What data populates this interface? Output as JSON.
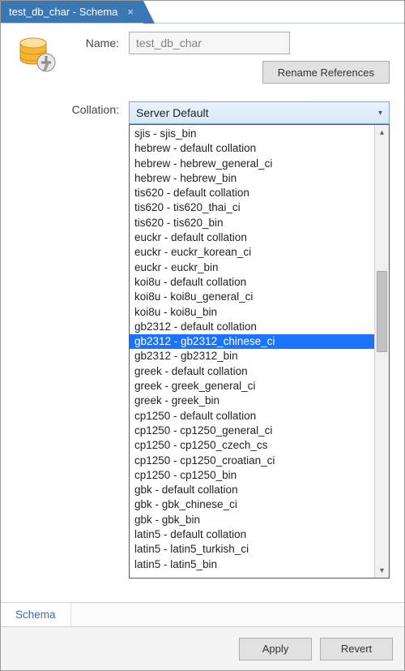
{
  "tab": {
    "title": "test_db_char - Schema",
    "close_tooltip": "Close"
  },
  "form": {
    "name_label": "Name:",
    "name_value": "test_db_char",
    "rename_label": "Rename References",
    "collation_label": "Collation:",
    "collation_selected": "Server Default"
  },
  "dropdown": {
    "highlighted_index": 14,
    "items": [
      "sjis - sjis_bin",
      "hebrew - default collation",
      "hebrew - hebrew_general_ci",
      "hebrew - hebrew_bin",
      "tis620 - default collation",
      "tis620 - tis620_thai_ci",
      "tis620 - tis620_bin",
      "euckr - default collation",
      "euckr - euckr_korean_ci",
      "euckr - euckr_bin",
      "koi8u - default collation",
      "koi8u - koi8u_general_ci",
      "koi8u - koi8u_bin",
      "gb2312 - default collation",
      "gb2312 - gb2312_chinese_ci",
      "gb2312 - gb2312_bin",
      "greek - default collation",
      "greek - greek_general_ci",
      "greek - greek_bin",
      "cp1250 - default collation",
      "cp1250 - cp1250_general_ci",
      "cp1250 - cp1250_czech_cs",
      "cp1250 - cp1250_croatian_ci",
      "cp1250 - cp1250_bin",
      "gbk - default collation",
      "gbk - gbk_chinese_ci",
      "gbk - gbk_bin",
      "latin5 - default collation",
      "latin5 - latin5_turkish_ci",
      "latin5 - latin5_bin"
    ]
  },
  "bottom_tabs": {
    "schema": "Schema"
  },
  "buttons": {
    "apply": "Apply",
    "revert": "Revert"
  }
}
